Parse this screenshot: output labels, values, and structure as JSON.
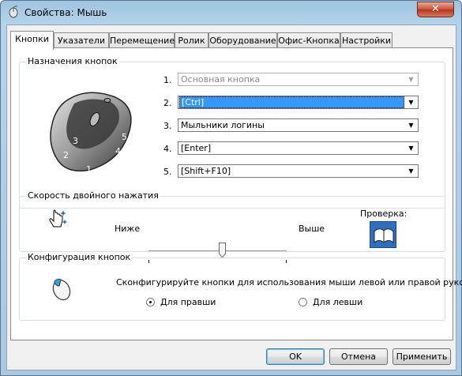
{
  "window": {
    "title": "Свойства: Мышь",
    "close_label": "✕",
    "icon": "mouse-icon"
  },
  "tabs": [
    {
      "label": "Кнопки",
      "active": true
    },
    {
      "label": "Указатели"
    },
    {
      "label": "Перемещение"
    },
    {
      "label": "Ролик"
    },
    {
      "label": "Оборудование"
    },
    {
      "label": "Офис-Кнопка"
    },
    {
      "label": "Настройки"
    }
  ],
  "button_assignment": {
    "title": "Назначения кнопок",
    "mouse_labels": [
      "1",
      "2",
      "3",
      "4",
      "5"
    ],
    "rows": [
      {
        "num": "1.",
        "value": "Основная кнопка",
        "disabled": true
      },
      {
        "num": "2.",
        "value": "[Ctrl]",
        "selected": true
      },
      {
        "num": "3.",
        "value": "Мыльники логины"
      },
      {
        "num": "4.",
        "value": "[Enter]"
      },
      {
        "num": "5.",
        "value": "[Shift+F10]"
      }
    ]
  },
  "double_click": {
    "title": "Скорость двойного нажатия",
    "low_label": "Ниже",
    "high_label": "Выше",
    "test_label": "Проверка:",
    "speed_level": 0.52
  },
  "button_config": {
    "title": "Конфигурация кнопок",
    "description": "Сконфигурируйте кнопки для использования мыши левой или правой рукой.",
    "right_hand_label": "Для правши",
    "left_hand_label": "Для левши",
    "selected": "right"
  },
  "footer": {
    "ok_label": "OK",
    "cancel_label": "Отмена",
    "apply_label": "Применить"
  },
  "colors": {
    "selection": "#3399ff",
    "titlebar": "#b5d3ea",
    "close_button": "#c7503a"
  }
}
